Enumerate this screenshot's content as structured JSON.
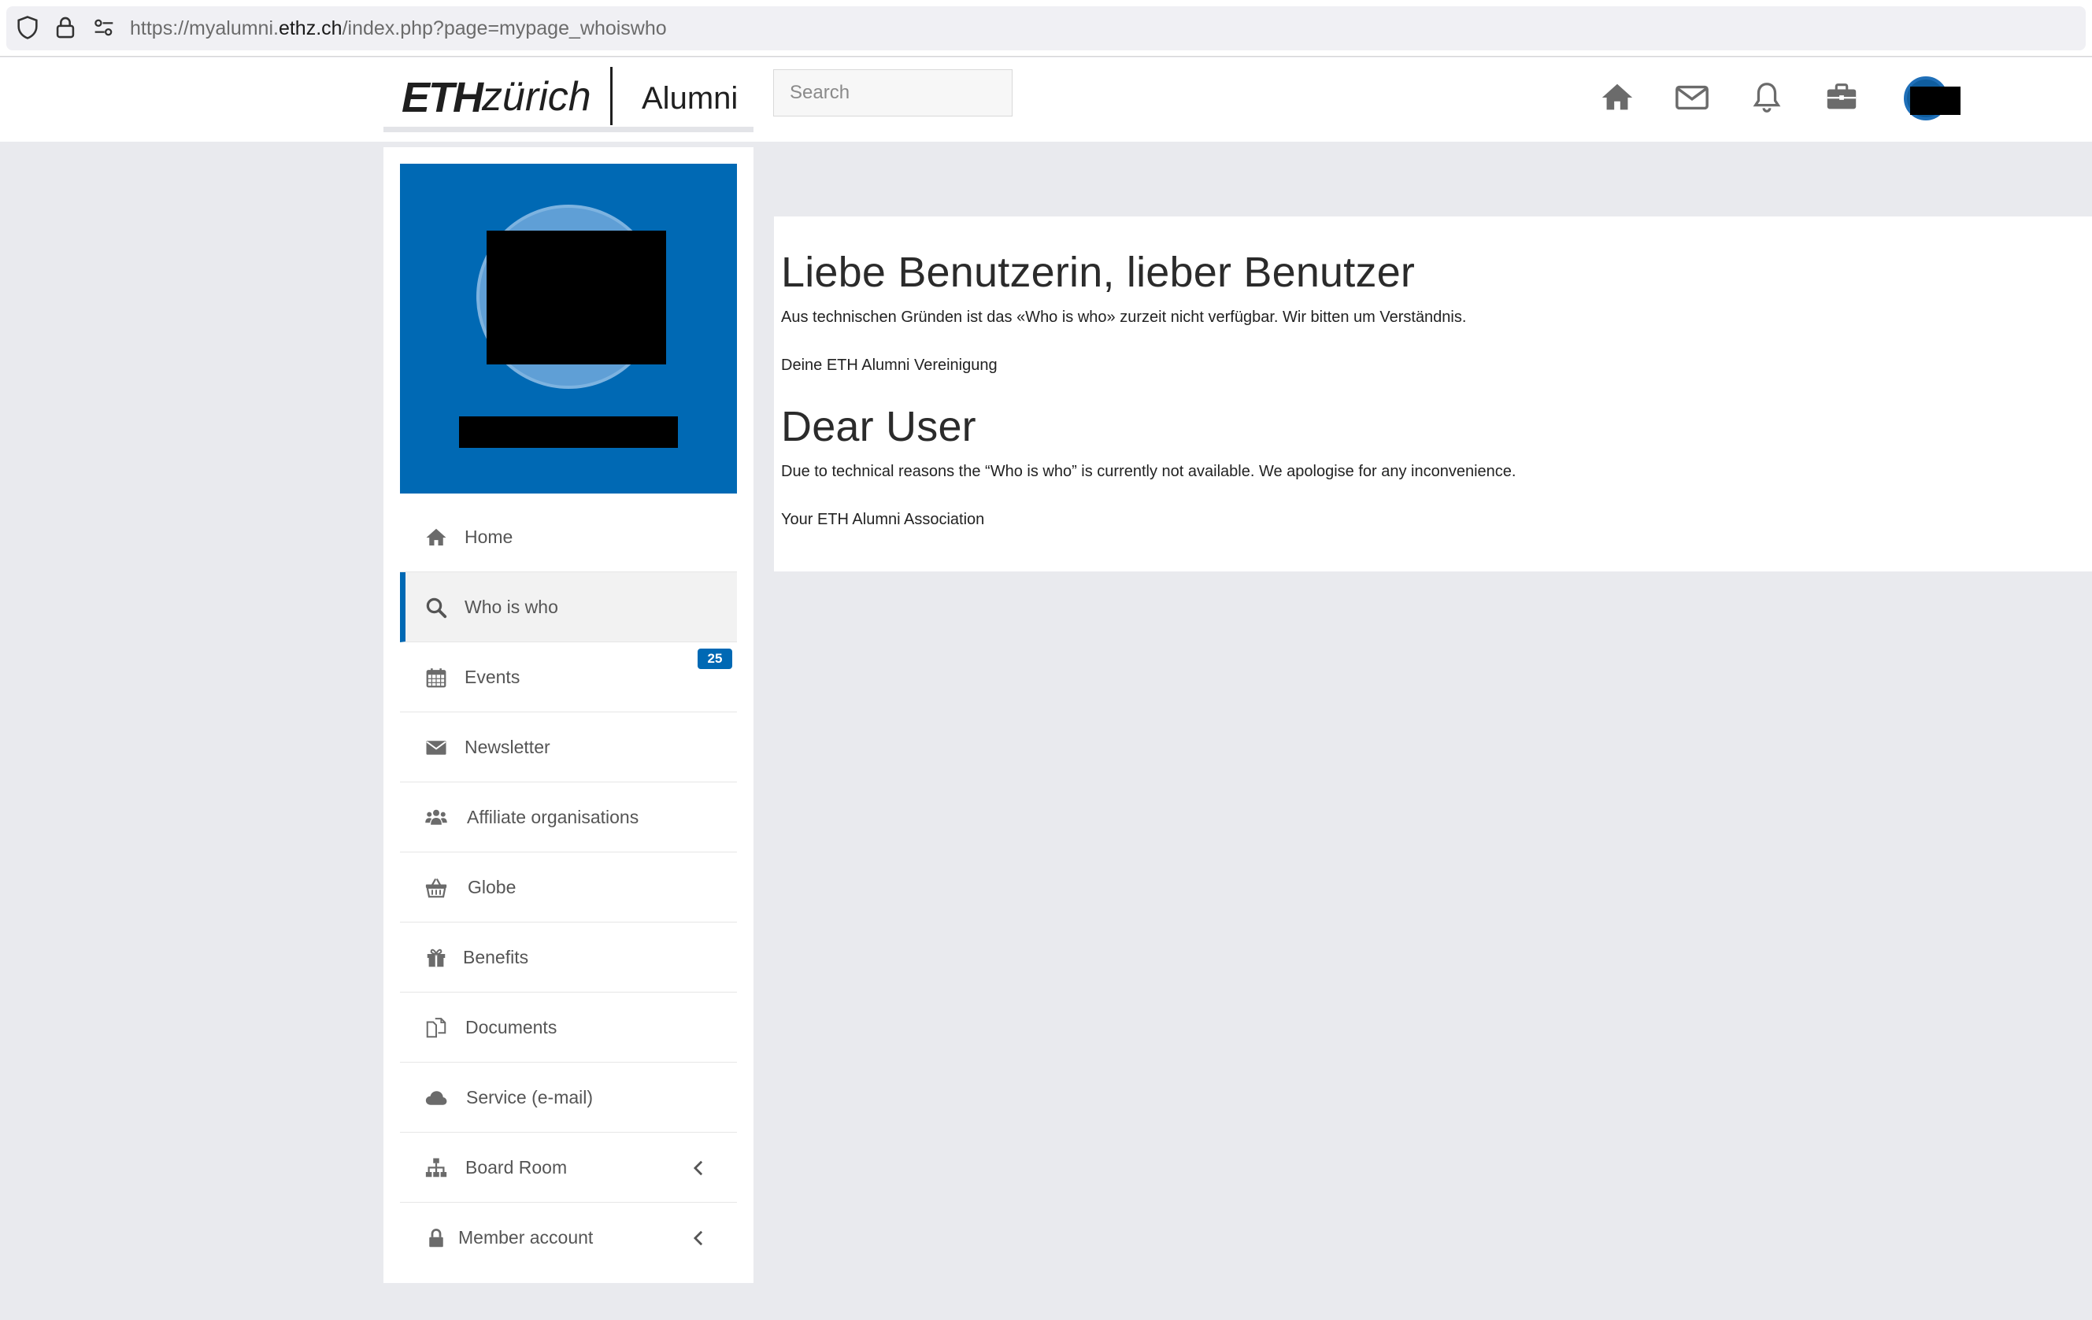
{
  "browser": {
    "url_prefix": "https://myalumni.",
    "url_host": "ethz.ch",
    "url_path": "/index.php?page=mypage_whoiswho"
  },
  "header": {
    "logo_eth": "ETH",
    "logo_zurich": "zürich",
    "logo_alumni": "Alumni",
    "search_placeholder": "Search",
    "icons": [
      "home-icon",
      "mail-icon",
      "bell-icon",
      "briefcase-icon"
    ]
  },
  "colors": {
    "brand_blue": "#0069b4",
    "icon_gray": "#6b6b6b",
    "page_bg": "#e9eaee"
  },
  "sidebar": {
    "items": [
      {
        "label": "Home",
        "icon": "home-icon"
      },
      {
        "label": "Who is who",
        "icon": "search-icon",
        "active": true
      },
      {
        "label": "Events",
        "icon": "calendar-icon",
        "badge": "25"
      },
      {
        "label": "Newsletter",
        "icon": "envelope-icon"
      },
      {
        "label": "Affiliate organisations",
        "icon": "users-icon"
      },
      {
        "label": "Globe",
        "icon": "basket-icon"
      },
      {
        "label": "Benefits",
        "icon": "gift-icon"
      },
      {
        "label": "Documents",
        "icon": "documents-icon"
      },
      {
        "label": "Service (e-mail)",
        "icon": "cloud-icon"
      },
      {
        "label": "Board Room",
        "icon": "sitemap-icon",
        "expandable": true
      },
      {
        "label": "Member account",
        "icon": "lock-icon",
        "expandable": true
      }
    ]
  },
  "main": {
    "de_heading": "Liebe Benutzerin, lieber Benutzer",
    "de_text": "Aus technischen Gründen ist das «Who is who» zurzeit nicht verfügbar. Wir bitten um Verständnis.",
    "de_sign": "Deine ETH Alumni Vereinigung",
    "en_heading": "Dear User",
    "en_text": "Due to technical reasons the “Who is who” is currently not available. We apologise for any inconvenience.",
    "en_sign": "Your ETH Alumni Association"
  }
}
